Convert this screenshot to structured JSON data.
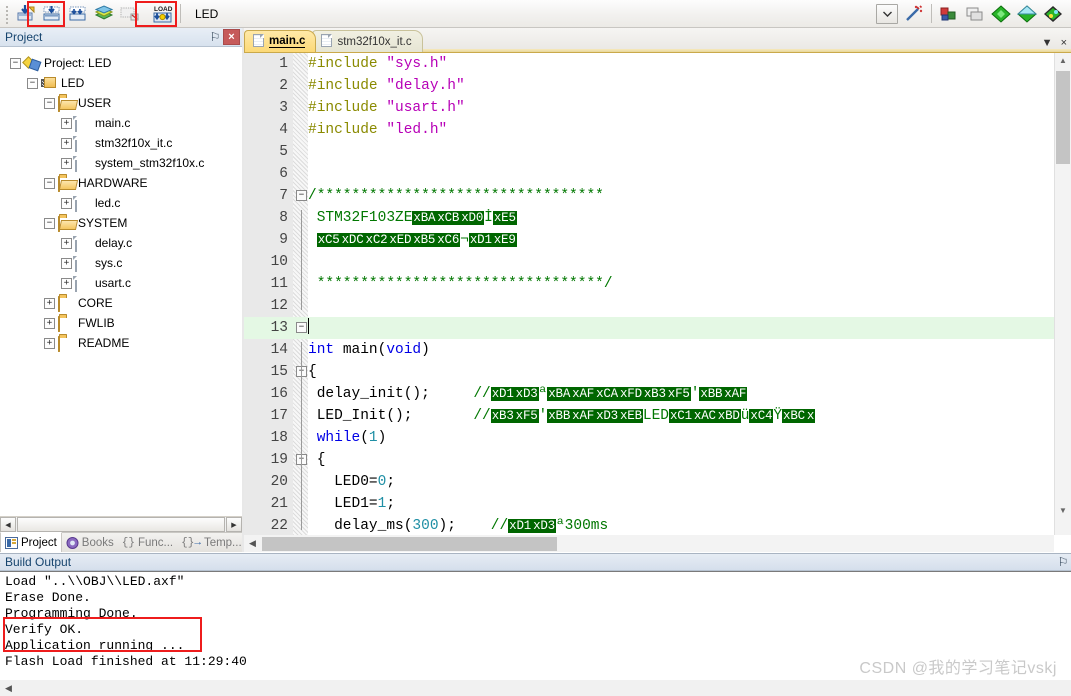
{
  "toolbar": {
    "project_name": "LED",
    "buttons": [
      {
        "name": "download-to-flash-icon",
        "label": "Download"
      },
      {
        "name": "start-stop-debug-icon",
        "label": "Start/Stop Debug Session"
      },
      {
        "name": "debug-step-icon",
        "label": "Debug"
      },
      {
        "name": "manage-project-items-icon",
        "label": "Manage Project Items"
      },
      {
        "name": "configure-target-icon",
        "label": "Configure Target"
      },
      {
        "name": "load-flash-icon",
        "label": "LOAD"
      }
    ],
    "right_buttons": [
      {
        "name": "combo-dropdown-icon",
        "label": "Select Target"
      },
      {
        "name": "configure-magic-wand-icon",
        "label": "Options for Target"
      },
      {
        "name": "project-window-icon",
        "label": "Project Window"
      },
      {
        "name": "books-window-icon",
        "label": "Books Window"
      },
      {
        "name": "functions-window-icon",
        "label": "Functions Window"
      },
      {
        "name": "templates-window-icon",
        "label": "Templates Window"
      },
      {
        "name": "build-output-window-icon",
        "label": "Build Output Window"
      }
    ]
  },
  "project_panel": {
    "title": "Project",
    "pin_glyph": "⚐",
    "close_glyph": "×",
    "tree": [
      {
        "depth": 0,
        "label": "Project: LED",
        "icon": "project-icon",
        "expander": "−"
      },
      {
        "depth": 1,
        "label": "LED",
        "icon": "target-icon",
        "expander": "−"
      },
      {
        "depth": 2,
        "label": "USER",
        "icon": "folder-open",
        "expander": "−"
      },
      {
        "depth": 3,
        "label": "main.c",
        "icon": "file-doc",
        "expander": "+"
      },
      {
        "depth": 3,
        "label": "stm32f10x_it.c",
        "icon": "file-doc",
        "expander": "+"
      },
      {
        "depth": 3,
        "label": "system_stm32f10x.c",
        "icon": "file-doc",
        "expander": "+"
      },
      {
        "depth": 2,
        "label": "HARDWARE",
        "icon": "folder-open",
        "expander": "−"
      },
      {
        "depth": 3,
        "label": "led.c",
        "icon": "file-doc",
        "expander": "+"
      },
      {
        "depth": 2,
        "label": "SYSTEM",
        "icon": "folder-open",
        "expander": "−"
      },
      {
        "depth": 3,
        "label": "delay.c",
        "icon": "file-doc",
        "expander": "+"
      },
      {
        "depth": 3,
        "label": "sys.c",
        "icon": "file-doc",
        "expander": "+"
      },
      {
        "depth": 3,
        "label": "usart.c",
        "icon": "file-doc",
        "expander": "+"
      },
      {
        "depth": 2,
        "label": "CORE",
        "icon": "folder-closed",
        "expander": "+"
      },
      {
        "depth": 2,
        "label": "FWLIB",
        "icon": "folder-closed",
        "expander": "+"
      },
      {
        "depth": 2,
        "label": "README",
        "icon": "folder-closed",
        "expander": "+"
      }
    ],
    "tabs": [
      {
        "label": "Project",
        "icon": "project-tab-icon",
        "active": true
      },
      {
        "label": "Books",
        "icon": "books-tab-icon",
        "active": false
      },
      {
        "label": "Func...",
        "icon": "functions-tab-icon",
        "active": false
      },
      {
        "label": "Temp...",
        "icon": "templates-tab-icon",
        "active": false
      }
    ]
  },
  "editor": {
    "tabs": [
      {
        "label": "main.c",
        "active": true
      },
      {
        "label": "stm32f10x_it.c",
        "active": false
      }
    ],
    "tab_dropdown_glyph": "▼",
    "tab_close_glyph": "×",
    "lines": [
      {
        "n": "1",
        "fold": "",
        "tokens": [
          {
            "t": "pre",
            "v": "#include "
          },
          {
            "t": "str",
            "v": "\"sys.h\""
          }
        ]
      },
      {
        "n": "2",
        "fold": "",
        "tokens": [
          {
            "t": "pre",
            "v": "#include "
          },
          {
            "t": "str",
            "v": "\"delay.h\""
          }
        ]
      },
      {
        "n": "3",
        "fold": "",
        "tokens": [
          {
            "t": "pre",
            "v": "#include "
          },
          {
            "t": "str",
            "v": "\"usart.h\""
          }
        ]
      },
      {
        "n": "4",
        "fold": "",
        "tokens": [
          {
            "t": "pre",
            "v": "#include "
          },
          {
            "t": "str",
            "v": "\"led.h\""
          }
        ]
      },
      {
        "n": "5",
        "fold": "",
        "tokens": []
      },
      {
        "n": "6",
        "fold": "",
        "tokens": []
      },
      {
        "n": "7",
        "fold": "-",
        "tokens": [
          {
            "t": "cmt",
            "v": "/*********************************"
          }
        ]
      },
      {
        "n": "8",
        "fold": "",
        "tokens": [
          {
            "t": "cmt",
            "v": " STM32F103ZE"
          },
          {
            "t": "moji",
            "v": "xBA"
          },
          {
            "t": "moji",
            "v": "xCB"
          },
          {
            "t": "moji",
            "v": "xD0"
          },
          {
            "t": "cmt",
            "v": "İ"
          },
          {
            "t": "moji",
            "v": "xE5"
          }
        ]
      },
      {
        "n": "9",
        "fold": "",
        "tokens": [
          {
            "t": "cmt",
            "v": " "
          },
          {
            "t": "moji",
            "v": "xC5"
          },
          {
            "t": "moji",
            "v": "xDC"
          },
          {
            "t": "moji",
            "v": "xC2"
          },
          {
            "t": "moji",
            "v": "xED"
          },
          {
            "t": "moji",
            "v": "xB5"
          },
          {
            "t": "moji",
            "v": "xC6"
          },
          {
            "t": "cmt",
            "v": "¬"
          },
          {
            "t": "moji",
            "v": "xD1"
          },
          {
            "t": "moji",
            "v": "xE9"
          }
        ]
      },
      {
        "n": "10",
        "fold": "",
        "tokens": []
      },
      {
        "n": "11",
        "fold": "",
        "tokens": [
          {
            "t": "cmt",
            "v": " *********************************/"
          }
        ]
      },
      {
        "n": "12",
        "fold": "",
        "tokens": []
      },
      {
        "n": "13",
        "fold": "-",
        "tokens": [],
        "current": true
      },
      {
        "n": "14",
        "fold": "",
        "tokens": [
          {
            "t": "kw",
            "v": "int "
          },
          {
            "t": "plain",
            "v": "main("
          },
          {
            "t": "kw",
            "v": "void"
          },
          {
            "t": "plain",
            "v": ")"
          }
        ]
      },
      {
        "n": "15",
        "fold": "-",
        "tokens": [
          {
            "t": "plain",
            "v": "{"
          }
        ]
      },
      {
        "n": "16",
        "fold": "",
        "tokens": [
          {
            "t": "plain",
            "v": " delay_init();     "
          },
          {
            "t": "cmt",
            "v": "//"
          },
          {
            "t": "moji",
            "v": "xD1"
          },
          {
            "t": "moji",
            "v": "xD3"
          },
          {
            "t": "cmt",
            "v": "ª"
          },
          {
            "t": "moji",
            "v": "xBA"
          },
          {
            "t": "moji",
            "v": "xAF"
          },
          {
            "t": "moji",
            "v": "xCA"
          },
          {
            "t": "moji",
            "v": "xFD"
          },
          {
            "t": "moji",
            "v": "xB3"
          },
          {
            "t": "moji",
            "v": "xF5"
          },
          {
            "t": "cmt",
            "v": "′"
          },
          {
            "t": "moji",
            "v": "xBB"
          },
          {
            "t": "moji",
            "v": "xAF"
          }
        ]
      },
      {
        "n": "17",
        "fold": "",
        "tokens": [
          {
            "t": "plain",
            "v": " LED_Init();       "
          },
          {
            "t": "cmt",
            "v": "//"
          },
          {
            "t": "moji",
            "v": "xB3"
          },
          {
            "t": "moji",
            "v": "xF5"
          },
          {
            "t": "cmt",
            "v": "′"
          },
          {
            "t": "moji",
            "v": "xBB"
          },
          {
            "t": "moji",
            "v": "xAF"
          },
          {
            "t": "moji",
            "v": "xD3"
          },
          {
            "t": "moji",
            "v": "xEB"
          },
          {
            "t": "cmt",
            "v": "LED"
          },
          {
            "t": "moji",
            "v": "xC1"
          },
          {
            "t": "moji",
            "v": "xAC"
          },
          {
            "t": "moji",
            "v": "xBD"
          },
          {
            "t": "cmt",
            "v": "ü"
          },
          {
            "t": "moji",
            "v": "xC4"
          },
          {
            "t": "cmt",
            "v": "Ÿ"
          },
          {
            "t": "moji",
            "v": "xBC"
          },
          {
            "t": "moji",
            "v": "x"
          }
        ]
      },
      {
        "n": "18",
        "fold": "",
        "tokens": [
          {
            "t": "plain",
            "v": " "
          },
          {
            "t": "kw",
            "v": "while"
          },
          {
            "t": "plain",
            "v": "("
          },
          {
            "t": "num",
            "v": "1"
          },
          {
            "t": "plain",
            "v": ")"
          }
        ]
      },
      {
        "n": "19",
        "fold": "-",
        "tokens": [
          {
            "t": "plain",
            "v": " {"
          }
        ]
      },
      {
        "n": "20",
        "fold": "",
        "tokens": [
          {
            "t": "plain",
            "v": "   LED0="
          },
          {
            "t": "num",
            "v": "0"
          },
          {
            "t": "plain",
            "v": ";"
          }
        ]
      },
      {
        "n": "21",
        "fold": "",
        "tokens": [
          {
            "t": "plain",
            "v": "   LED1="
          },
          {
            "t": "num",
            "v": "1"
          },
          {
            "t": "plain",
            "v": ";"
          }
        ]
      },
      {
        "n": "22",
        "fold": "",
        "tokens": [
          {
            "t": "plain",
            "v": "   delay_ms("
          },
          {
            "t": "num",
            "v": "300"
          },
          {
            "t": "plain",
            "v": ");    "
          },
          {
            "t": "cmt",
            "v": "//"
          },
          {
            "t": "moji",
            "v": "xD1"
          },
          {
            "t": "moji",
            "v": "xD3"
          },
          {
            "t": "cmt",
            "v": "ª300ms"
          }
        ]
      }
    ]
  },
  "build_output": {
    "title": "Build Output",
    "pin_glyph": "⚐",
    "lines": [
      {
        "text": "Load \"..\\\\OBJ\\\\LED.axf\"",
        "highlight": false
      },
      {
        "text": "Erase Done.",
        "highlight": false
      },
      {
        "text": "Programming Done.",
        "highlight": false
      },
      {
        "text": "Verify OK.",
        "highlight": true
      },
      {
        "text": "Application running ...",
        "highlight": true
      },
      {
        "text": "Flash Load finished at 11:29:40",
        "highlight": false
      }
    ]
  },
  "watermark": {
    "text": "CSDN @我的学习笔记vskj"
  },
  "colors": {
    "highlight_box": "#ee1c1c",
    "mojibake_bg": "#006600",
    "comment": "#007700",
    "keyword": "#0000e6",
    "string": "#b700b7",
    "preprocessor": "#8a8a00",
    "number": "#1f8fa5",
    "current_line": "#e4f8e4",
    "active_tab": "#fcd977"
  }
}
